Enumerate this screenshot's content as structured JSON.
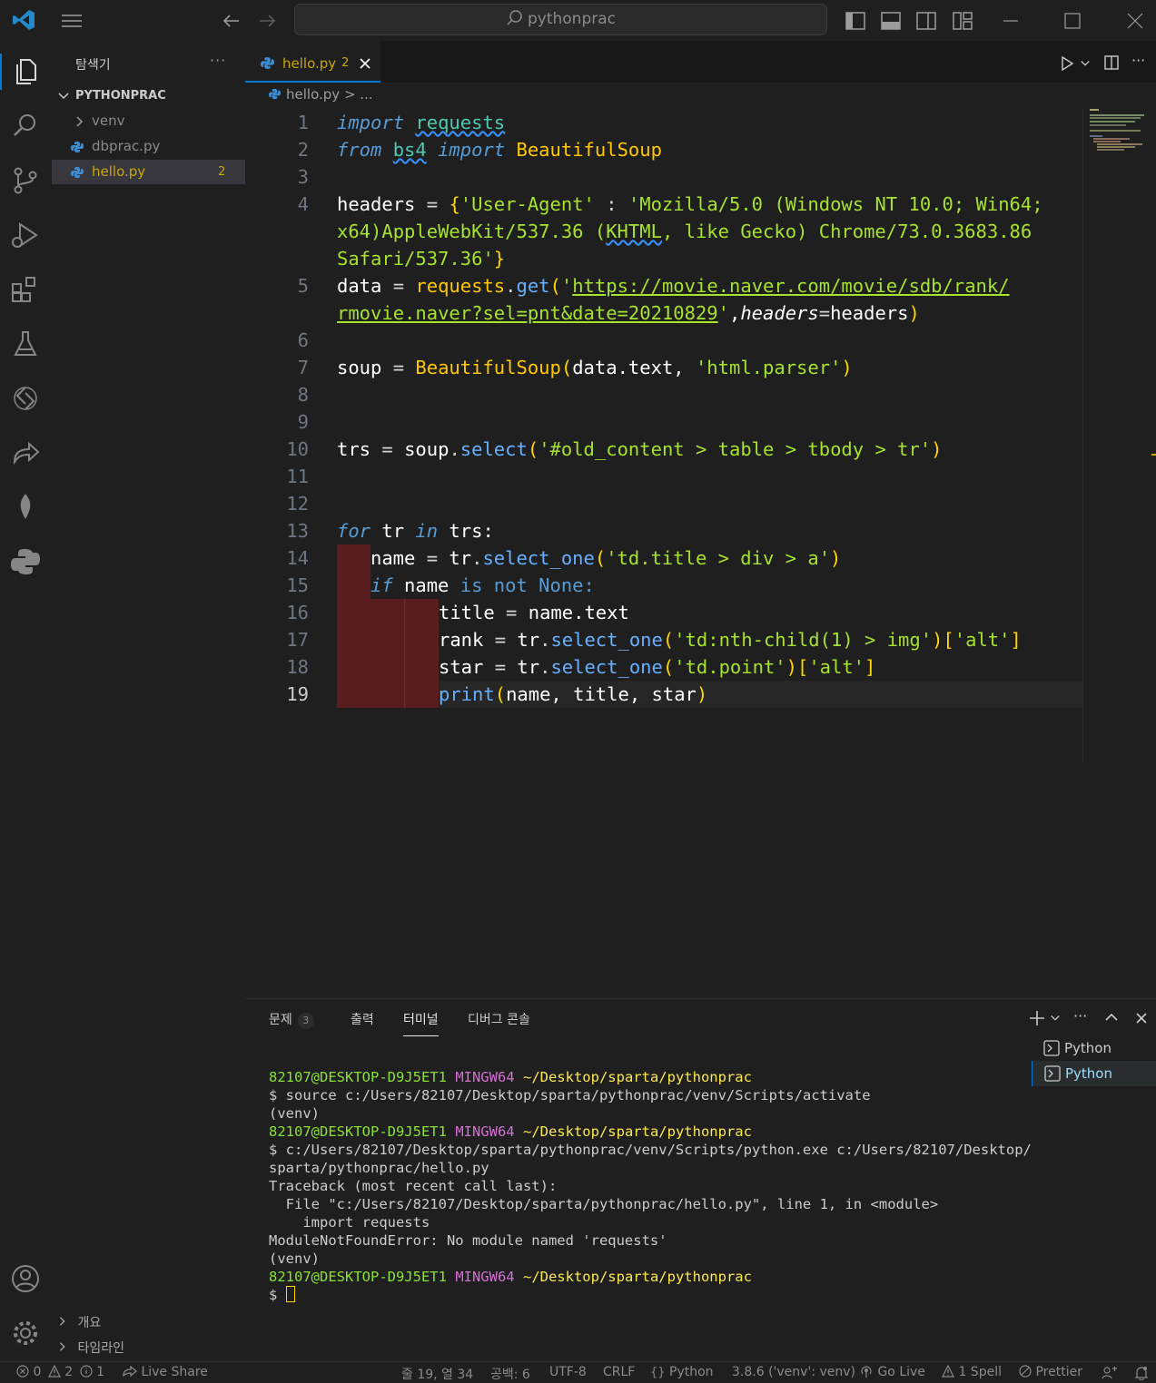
{
  "title_bar": {
    "search_text": "pythonprac"
  },
  "sidebar": {
    "title": "탐색기",
    "more": "···",
    "section": "PYTHONPRAC",
    "tree": [
      {
        "name": "venv",
        "type": "folder"
      },
      {
        "name": "dbprac.py",
        "type": "file"
      },
      {
        "name": "hello.py",
        "type": "file",
        "badge": "2",
        "selected": true
      }
    ],
    "bottom": [
      "개요",
      "타임라인"
    ]
  },
  "editor": {
    "tab": {
      "label": "hello.py",
      "badge": "2"
    },
    "breadcrumb": {
      "file": "hello.py",
      "sep": ">",
      "rest": "..."
    },
    "line_numbers": [
      "1",
      "2",
      "3",
      "4",
      "",
      "",
      "5",
      "",
      "6",
      "7",
      "8",
      "9",
      "10",
      "11",
      "12",
      "13",
      "14",
      "15",
      "16",
      "17",
      "18",
      "19"
    ],
    "lines": {
      "l1_import": "import",
      "l1_mod": "requests",
      "l2_from": "from",
      "l2_mod": "bs4",
      "l2_import": "import",
      "l2_cls": "BeautifulSoup",
      "l4a_var": "headers",
      "l4a_eq": " = ",
      "l4a_brace": "{",
      "l4a_key": "'User-Agent'",
      "l4a_colon": " : ",
      "l4a_val": "'Mozilla/5.0 (Windows NT 10.0; Win64;",
      "l4b_val1": "x64)AppleWebKit/537.36 (",
      "l4b_khtml": "KHTML",
      "l4b_val2": ", like Gecko) Chrome/73.0.3683.86",
      "l4c_val": "Safari/537.36'",
      "l4c_brace": "}",
      "l5a_var": "data",
      "l5a_eq": " = ",
      "l5a_obj": "requests",
      "l5a_dot": ".",
      "l5a_fn": "get",
      "l5a_paren": "(",
      "l5a_q": "'",
      "l5a_url": "https://movie.naver.com/movie/sdb/rank/",
      "l5b_url": "rmovie.naver?sel=pnt&date=20210829",
      "l5b_q": "'",
      "l5b_comma": ",",
      "l5b_kw": "headers",
      "l5b_eq": "=",
      "l5b_val": "headers",
      "l5b_paren": ")",
      "l7_var": "soup",
      "l7_eq": " = ",
      "l7_cls": "BeautifulSoup",
      "l7_paren": "(",
      "l7_arg": "data.text, ",
      "l7_str": "'html.parser'",
      "l7_close": ")",
      "l10_var": "trs",
      "l10_eq": " = ",
      "l10_obj": "soup",
      "l10_dot": ".",
      "l10_fn": "select",
      "l10_paren": "(",
      "l10_str": "'#old_content > table > tbody > tr'",
      "l10_close": ")",
      "l13_for": "for",
      "l13_mid": " tr ",
      "l13_in": "in",
      "l13_end": " trs:",
      "l14_var": "name",
      "l14_eq": " = ",
      "l14_obj": "tr",
      "l14_dot": ".",
      "l14_fn": "select_one",
      "l14_paren": "(",
      "l14_str": "'td.title > div > a'",
      "l14_close": ")",
      "l15_if": "if",
      "l15_mid": " name ",
      "l15_is": "is not",
      "l15_none": " None:",
      "l16_var": "title",
      "l16_eq": " = ",
      "l16_val": "name.text",
      "l17_var": "rank",
      "l17_eq": " = ",
      "l17_obj": "tr",
      "l17_dot": ".",
      "l17_fn": "select_one",
      "l17_paren": "(",
      "l17_str": "'td:nth-child(1) > img'",
      "l17_close": ")",
      "l17_br": "[",
      "l17_key": "'alt'",
      "l17_brc": "]",
      "l18_var": "star",
      "l18_eq": " = ",
      "l18_obj": "tr",
      "l18_dot": ".",
      "l18_fn": "select_one",
      "l18_paren": "(",
      "l18_str": "'td.point'",
      "l18_close": ")",
      "l18_br": "[",
      "l18_key": "'alt'",
      "l18_brc": "]",
      "l19_fn": "print",
      "l19_paren": "(",
      "l19_args": "name, title, star",
      "l19_close": ")"
    }
  },
  "panel": {
    "tabs": [
      {
        "label": "문제",
        "badge": "3"
      },
      {
        "label": "출력"
      },
      {
        "label": "터미널",
        "active": true
      },
      {
        "label": "디버그 콘솔"
      }
    ],
    "terminals": [
      "Python",
      "Python"
    ],
    "terminal": {
      "prompt_user": "82107@DESKTOP-D9J5ET1",
      "prompt_env": "MINGW64",
      "prompt_path": "~/Desktop/sparta/pythonprac",
      "cmd1": "$ source c:/Users/82107/Desktop/sparta/pythonprac/venv/Scripts/activate",
      "venv": "(venv)",
      "cmd2a": "$ c:/Users/82107/Desktop/sparta/pythonprac/venv/Scripts/python.exe c:/Users/82107/Desktop/",
      "cmd2b": "sparta/pythonprac/hello.py",
      "tb1": "Traceback (most recent call last):",
      "tb2": "  File \"c:/Users/82107/Desktop/sparta/pythonprac/hello.py\", line 1, in <module>",
      "tb3": "    import requests",
      "tb4": "ModuleNotFoundError: No module named 'requests'",
      "prompt_end": "$ "
    }
  },
  "status_bar": {
    "errors": "0",
    "warnings": "2",
    "infos": "1",
    "live_share": "Live Share",
    "position": "줄 19, 열 34",
    "spaces": "공백: 6",
    "encoding": "UTF-8",
    "eol": "CRLF",
    "language": "Python",
    "interpreter": "3.8.6 ('venv': venv)",
    "go_live": "Go Live",
    "spell": "1 Spell",
    "prettier": "Prettier"
  },
  "colors": {
    "accent": "#0078d4",
    "indent_error": "#5a1d1d",
    "keyword": "#569cd6",
    "string": "#a6e22e",
    "class": "#ffc800"
  }
}
